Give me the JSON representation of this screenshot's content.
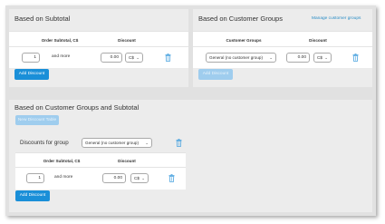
{
  "subtotal_panel": {
    "title": "Based on Subtotal",
    "col_subtotal": "Order Subtotal, C$",
    "col_discount": "Discount",
    "row": {
      "subtotal": "1",
      "suffix": "and more",
      "discount": "0.00",
      "currency": "C$"
    },
    "add_button": "Add Discount"
  },
  "groups_panel": {
    "title": "Based on Customer Groups",
    "manage_link": "Manage customer groups",
    "col_groups": "Customer Groups",
    "col_discount": "Discount",
    "row": {
      "group": "General (no customer group)",
      "discount": "0.00",
      "currency": "C$"
    },
    "add_button": "Add Discount"
  },
  "combined_panel": {
    "title": "Based on Customer Groups and Subtotal",
    "new_table_button": "New Discount Table",
    "group_label": "Discounts for group",
    "group_value": "General (no customer group)",
    "col_subtotal": "Order Subtotal, C$",
    "col_discount": "Discount",
    "row": {
      "subtotal": "1",
      "suffix": "and more",
      "discount": "0.00",
      "currency": "C$"
    },
    "add_button": "Add Discount"
  },
  "colors": {
    "accent": "#1a8fd8",
    "accent_disabled": "#9fcdee",
    "link": "#2a8dc6"
  },
  "icons": [
    "trash-icon",
    "chevron-down-icon"
  ]
}
